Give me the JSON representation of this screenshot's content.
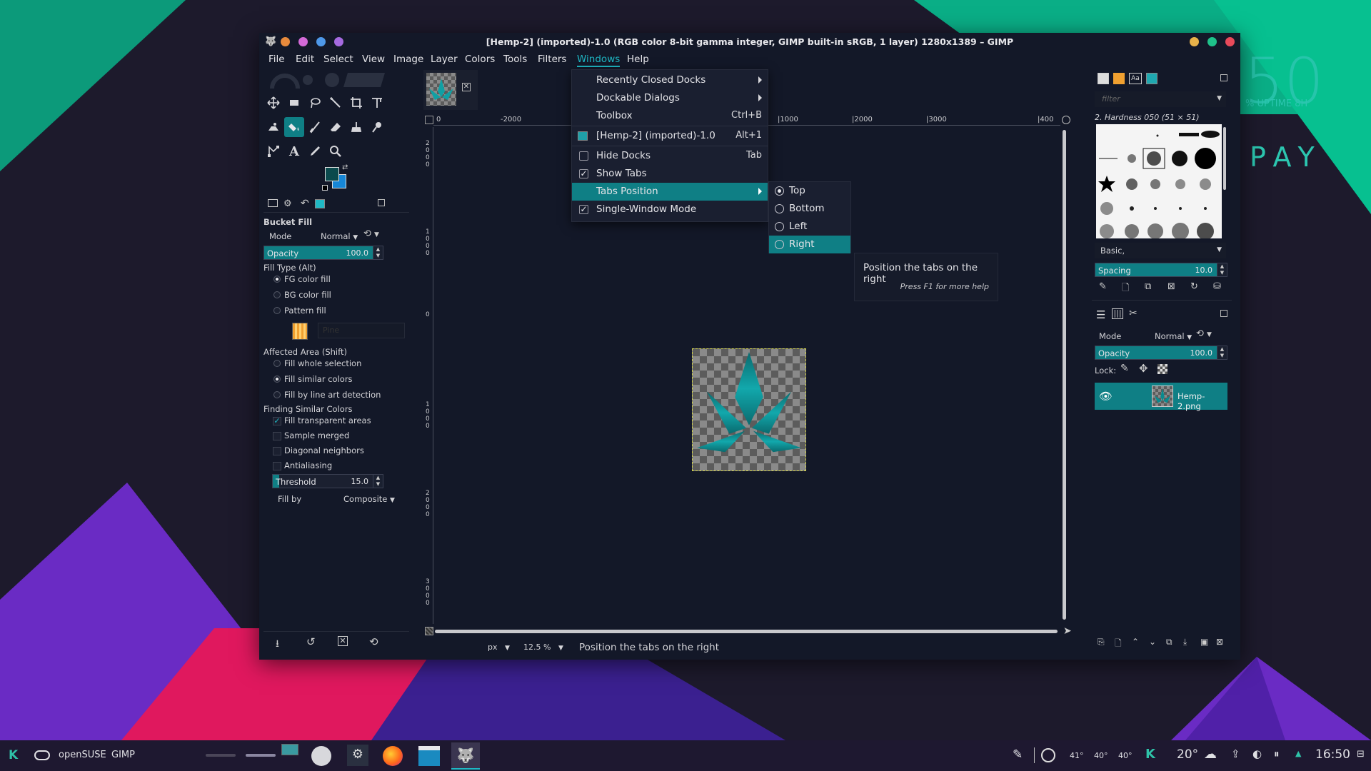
{
  "window": {
    "title": "[Hemp-2] (imported)-1.0 (RGB color 8-bit gamma integer, GIMP built-in sRGB, 1 layer) 1280x1389 – GIMP"
  },
  "menubar": [
    "File",
    "Edit",
    "Select",
    "View",
    "Image",
    "Layer",
    "Colors",
    "Tools",
    "Filters",
    "Windows",
    "Help"
  ],
  "toolbox": {
    "tool_options_title": "Bucket Fill",
    "mode_label": "Mode",
    "mode_value": "Normal",
    "opacity_label": "Opacity",
    "opacity_value": "100.0",
    "fill_type_label": "Fill Type  (Alt)",
    "fill_types": [
      "FG color fill",
      "BG color fill",
      "Pattern fill"
    ],
    "pattern_name": "Pine",
    "affected_area_label": "Affected Area  (Shift)",
    "affected_areas": [
      "Fill whole selection",
      "Fill similar colors",
      "Fill by line art detection"
    ],
    "finding_label": "Finding Similar Colors",
    "finding_options": [
      "Fill transparent areas",
      "Sample merged",
      "Diagonal neighbors",
      "Antialiasing"
    ],
    "threshold_label": "Threshold",
    "threshold_value": "15.0",
    "fill_by_label": "Fill by",
    "fill_by_value": "Composite"
  },
  "canvas": {
    "ruler_top": [
      "0",
      "-2000",
      "|1000",
      "|2000",
      "|3000",
      "|400"
    ],
    "ruler_left": [
      "2\n0\n0\n0",
      "1\n0\n0\n0",
      "0",
      "1\n0\n0\n0",
      "2\n0\n0\n0",
      "3\n0\n0\n0"
    ],
    "unit": "px",
    "zoom": "12.5 %",
    "status": "Position the tabs on the right"
  },
  "windows_menu": {
    "items": [
      {
        "label": "Recently Closed Docks",
        "shortcut": ""
      },
      {
        "label": "Dockable Dialogs",
        "shortcut": ""
      },
      {
        "label": "Toolbox",
        "shortcut": "Ctrl+B"
      },
      {
        "label": "[Hemp-2] (imported)-1.0",
        "shortcut": "Alt+1"
      },
      {
        "label": "Hide Docks",
        "shortcut": "Tab"
      },
      {
        "label": "Show Tabs",
        "shortcut": ""
      },
      {
        "label": "Tabs Position",
        "shortcut": ""
      },
      {
        "label": "Single-Window Mode",
        "shortcut": ""
      }
    ]
  },
  "tabs_position_menu": [
    "Top",
    "Bottom",
    "Left",
    "Right"
  ],
  "tabs_position_selected": "Top",
  "tooltip": {
    "text": "Position the tabs on the right",
    "help": "Press F1 for more help"
  },
  "right_dock": {
    "filter_placeholder": "filter",
    "brush_name": "2. Hardness 050 (51 × 51)",
    "brush_preset": "Basic,",
    "spacing_label": "Spacing",
    "spacing_value": "10.0",
    "layers_mode_label": "Mode",
    "layers_mode_value": "Normal",
    "layers_opacity_label": "Opacity",
    "layers_opacity_value": "100.0",
    "lock_label": "Lock:",
    "layer_name": "Hemp-2.png"
  },
  "desktop": {
    "bg_text_1": "50",
    "bg_text_2": "% UPTIME 8H",
    "bg_text_3": "PAY"
  },
  "taskbar": {
    "distro": "openSUSE",
    "app": "GIMP",
    "temps": [
      "41°",
      "40°",
      "40°"
    ],
    "weather": "20°",
    "time": "16:50"
  },
  "colors": {
    "accent": "#0f7f85",
    "accent_text": "#1fb8c4",
    "window_bg": "#131828",
    "fg_color": "#0b4a4d",
    "bg_color": "#1686d6"
  }
}
